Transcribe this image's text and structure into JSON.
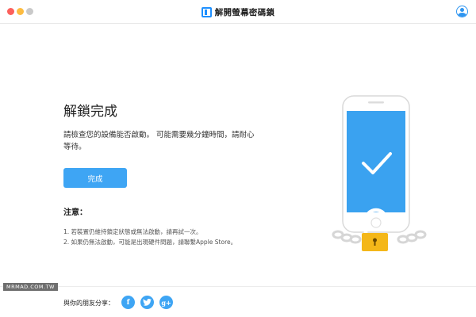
{
  "window": {
    "title": "解開螢幕密碼鎖",
    "app_icon": "app-logo-icon",
    "account_icon": "user-account-icon"
  },
  "main": {
    "title": "解鎖完成",
    "description": "請檢查您的設備能否啟動。 可能需要幾分鐘時間，請耐心等待。",
    "done_button_label": "完成",
    "note_title": "注意：",
    "notes": [
      "1. 若裝置仍維持鎖定狀態或無法啟動，請再試一次。",
      "2. 如果仍無法啟動，可能是出現硬件問題，請聯繫Apple Store。"
    ]
  },
  "footer": {
    "share_label": "與你的朋友分享：",
    "watermark": "MRMAD.COM.TW",
    "social": [
      {
        "name": "facebook",
        "glyph": "f"
      },
      {
        "name": "twitter",
        "glyph": "t"
      },
      {
        "name": "google-plus",
        "glyph": "g+"
      }
    ]
  },
  "colors": {
    "accent": "#3ea5f4",
    "lock": "#f4b719",
    "screen": "#3aa2f0"
  }
}
